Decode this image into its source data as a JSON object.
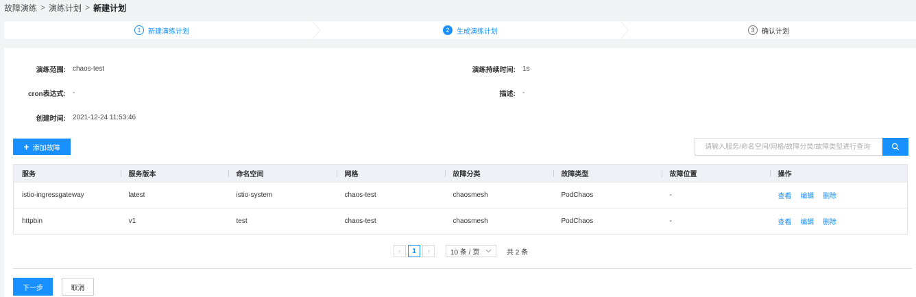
{
  "breadcrumb": {
    "items": [
      "故障演练",
      "演练计划"
    ],
    "current": "新建计划",
    "separator": ">"
  },
  "steps": [
    {
      "num": "1",
      "label": "新建演练计划",
      "state": "done"
    },
    {
      "num": "2",
      "label": "生成演练计划",
      "state": "active"
    },
    {
      "num": "3",
      "label": "确认计划",
      "state": "pending"
    }
  ],
  "info": {
    "scope_label": "演练范围:",
    "scope_value": "chaos-test",
    "duration_label": "演练持续时间:",
    "duration_value": "1s",
    "cron_label": "cron表达式:",
    "cron_value": "-",
    "desc_label": "描述:",
    "desc_value": "-",
    "created_label": "创建时间:",
    "created_value": "2021-12-24 11:53:46"
  },
  "toolbar": {
    "add_label": "添加故障",
    "search_placeholder": "请输入服务/命名空间/网格/故障分类/故障类型进行查询"
  },
  "table": {
    "headers": [
      "服务",
      "服务版本",
      "命名空间",
      "网格",
      "故障分类",
      "故障类型",
      "故障位置",
      "操作"
    ],
    "rows": [
      {
        "service": "istio-ingressgateway",
        "version": "latest",
        "namespace": "istio-system",
        "mesh": "chaos-test",
        "category": "chaosmesh",
        "type": "PodChaos",
        "location": "-",
        "view": "查看",
        "edit": "编辑",
        "delete": "删除"
      },
      {
        "service": "httpbin",
        "version": "v1",
        "namespace": "test",
        "mesh": "chaos-test",
        "category": "chaosmesh",
        "type": "PodChaos",
        "location": "-",
        "view": "查看",
        "edit": "编辑",
        "delete": "删除"
      }
    ]
  },
  "pagination": {
    "current_page": "1",
    "page_size": "10 条 / 页",
    "total": "共 2 条"
  },
  "footer": {
    "next_label": "下一步",
    "cancel_label": "取消"
  },
  "colors": {
    "primary": "#1890ff",
    "background": "#f2f3f5",
    "header_bg": "#eef1f5"
  }
}
